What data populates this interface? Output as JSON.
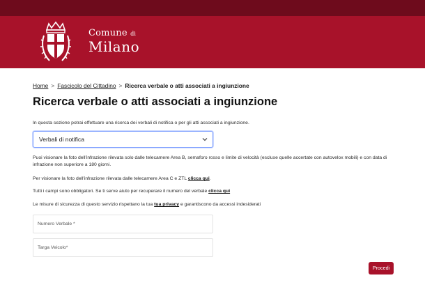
{
  "header": {
    "brand_line1": "Comune",
    "brand_line1_small": "di",
    "brand_line2": "Milano"
  },
  "breadcrumb": {
    "home": "Home",
    "section": "Fascicolo del Cittadino",
    "separator": ">",
    "current": "Ricerca verbale o atti associati a ingiunzione"
  },
  "page_title": "Ricerca verbale o atti associati a ingiunzione",
  "intro": "In questa sezione potrai effettuare una ricerca dei verbali di notifica o per gli atti associati a ingiunzione.",
  "search_type": {
    "selected": "Verbali di notifica"
  },
  "info": {
    "p1": "Puoi visionare la foto dell'infrazione rilevata solo dalle telecamere Area B, semaforo rosso e limite di velocità (escluse quelle accertate con autovelox mobili) e con data di infrazione non superiore a 180 giorni.",
    "p2_text": "Per visionare la foto dell'infrazione rilevata dalle telecamere Area C e ZTL ",
    "p2_link": "clicca qui",
    "p2_end": ".",
    "p3_text": "Tutti i campi sono obbligatori. Se ti serve aiuto per recuperare il numero del verbale ",
    "p3_link": "clicca qui",
    "p4_text": "Le misure di sicurezza di questo servizio rispettano la tua ",
    "p4_link": "tua privacy",
    "p4_end": " e garantiscono da accessi indesiderati"
  },
  "form": {
    "numero_verbale_placeholder": "Numero Verbale *",
    "targa_placeholder": "Targa Veicolo*"
  },
  "actions": {
    "proceed_label": "Procedi"
  },
  "colors": {
    "brand_red": "#a8122a",
    "dark_red": "#6e0b1c"
  },
  "icons": {
    "logo": "comune-di-milano-crest-icon",
    "select_chevron": "chevron-down-icon"
  }
}
